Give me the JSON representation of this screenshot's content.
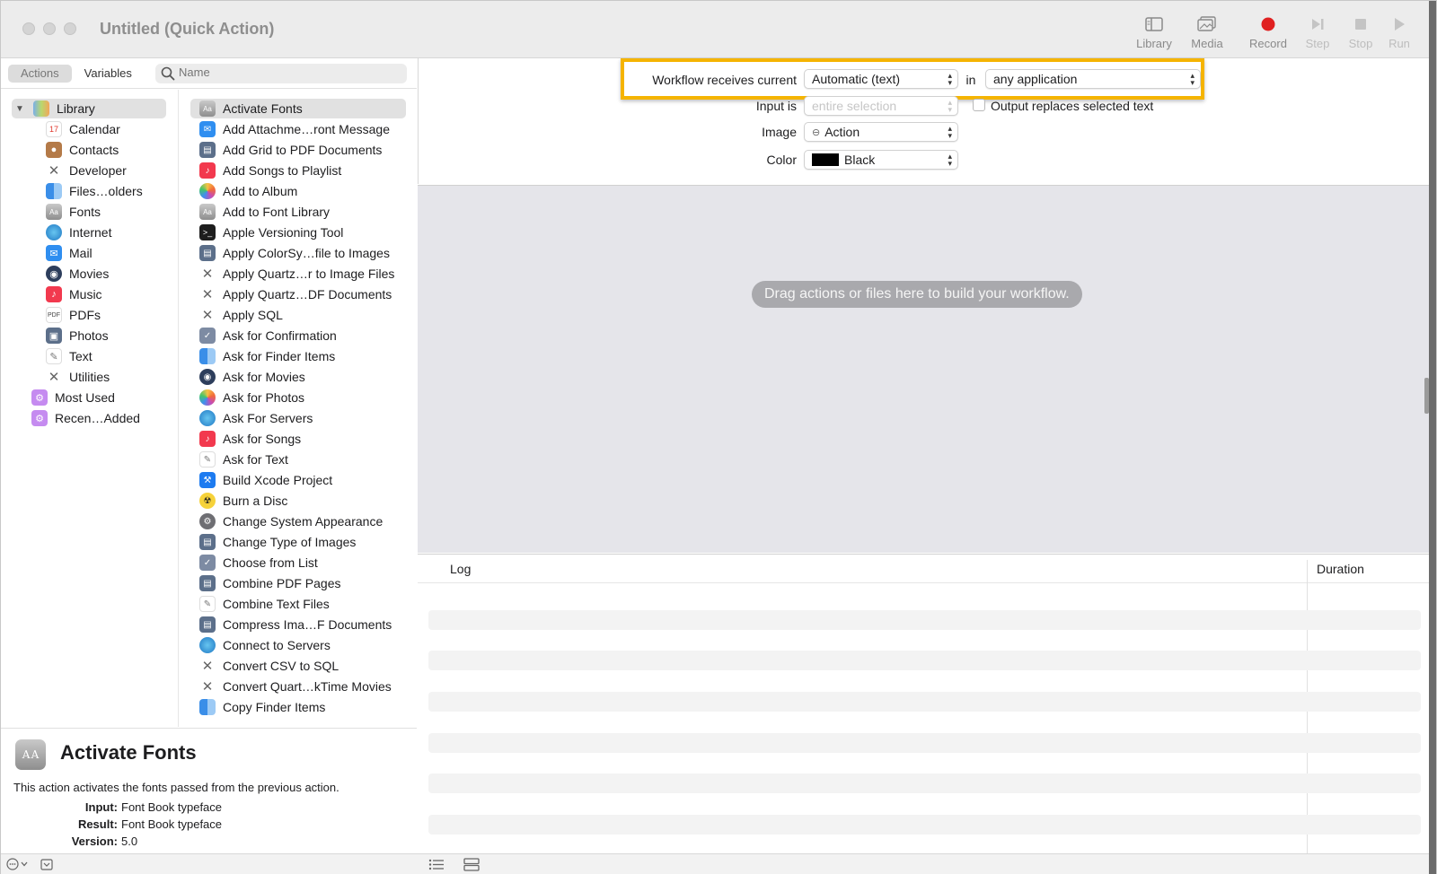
{
  "window": {
    "title": "Untitled (Quick Action)",
    "toolbar": {
      "library": "Library",
      "media": "Media",
      "record": "Record",
      "step": "Step",
      "stop": "Stop",
      "run": "Run"
    }
  },
  "sidebar": {
    "tabs": {
      "actions": "Actions",
      "variables": "Variables"
    },
    "search_placeholder": "Name",
    "library": [
      {
        "label": "Library",
        "icon": "library-icon"
      },
      {
        "label": "Calendar",
        "icon": "calendar-icon"
      },
      {
        "label": "Contacts",
        "icon": "contacts-icon"
      },
      {
        "label": "Developer",
        "icon": "developer-icon"
      },
      {
        "label": "Files…olders",
        "icon": "finder-icon"
      },
      {
        "label": "Fonts",
        "icon": "fonts-icon"
      },
      {
        "label": "Internet",
        "icon": "internet-icon"
      },
      {
        "label": "Mail",
        "icon": "mail-icon"
      },
      {
        "label": "Movies",
        "icon": "movies-icon"
      },
      {
        "label": "Music",
        "icon": "music-icon"
      },
      {
        "label": "PDFs",
        "icon": "pdf-icon"
      },
      {
        "label": "Photos",
        "icon": "photos-icon"
      },
      {
        "label": "Text",
        "icon": "text-icon"
      },
      {
        "label": "Utilities",
        "icon": "utilities-icon"
      },
      {
        "label": "Most Used",
        "icon": "smart-folder-icon"
      },
      {
        "label": "Recen…Added",
        "icon": "smart-folder-icon"
      }
    ],
    "actions": [
      "Activate Fonts",
      "Add Attachme…ront Message",
      "Add Grid to PDF Documents",
      "Add Songs to Playlist",
      "Add to Album",
      "Add to Font Library",
      "Apple Versioning Tool",
      "Apply ColorSy…file to Images",
      "Apply Quartz…r to Image Files",
      "Apply Quartz…DF Documents",
      "Apply SQL",
      "Ask for Confirmation",
      "Ask for Finder Items",
      "Ask for Movies",
      "Ask for Photos",
      "Ask For Servers",
      "Ask for Songs",
      "Ask for Text",
      "Build Xcode Project",
      "Burn a Disc",
      "Change System Appearance",
      "Change Type of Images",
      "Choose from List",
      "Combine PDF Pages",
      "Combine Text Files",
      "Compress Ima…F Documents",
      "Connect to Servers",
      "Convert CSV to SQL",
      "Convert Quart…kTime Movies",
      "Copy Finder Items"
    ]
  },
  "description": {
    "title": "Activate Fonts",
    "text": "This action activates the fonts passed from the previous action.",
    "input_label": "Input:",
    "input_value": "Font Book typeface",
    "result_label": "Result:",
    "result_value": "Font Book typeface",
    "version_label": "Version:",
    "version_value": "5.0"
  },
  "workflow": {
    "receives_label": "Workflow receives current",
    "receives_value": "Automatic (text)",
    "in_label": "in",
    "app_value": "any application",
    "input_is_label": "Input is",
    "input_is_value": "entire selection",
    "output_replaces_label": "Output replaces selected text",
    "image_label": "Image",
    "image_value": "Action",
    "color_label": "Color",
    "color_value": "Black",
    "color_swatch": "#000000",
    "drop_hint": "Drag actions or files here to build your workflow."
  },
  "log": {
    "col_log": "Log",
    "col_duration": "Duration"
  },
  "colors": {
    "highlight": "#f5b400",
    "record": "#e02020",
    "canvas": "#e5e5ea"
  }
}
